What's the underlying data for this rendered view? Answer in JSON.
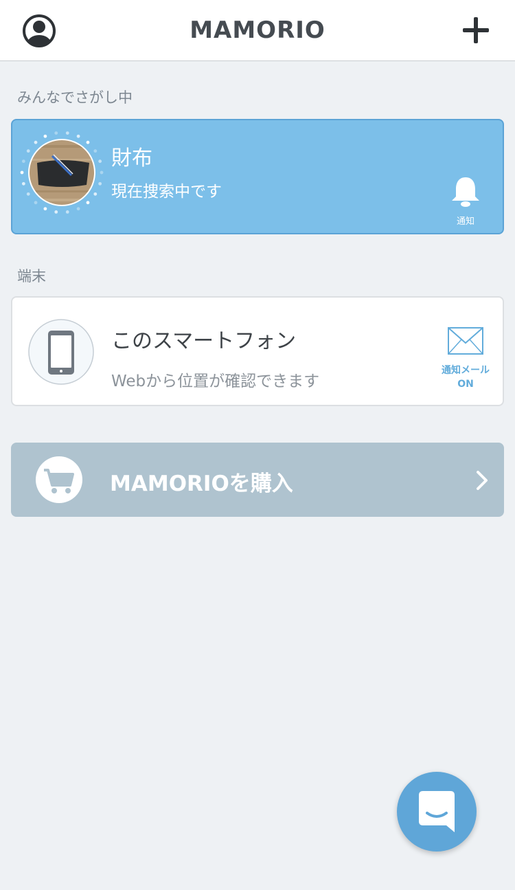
{
  "header": {
    "logo_text": "MAMORIO",
    "profile_icon": "user-circle-icon",
    "add_icon": "plus-icon"
  },
  "sections": {
    "searching_label": "みんなでさがし中",
    "devices_label": "端末"
  },
  "searching_item": {
    "name": "財布",
    "status": "現在捜索中です",
    "notify_label": "通知",
    "notify_icon": "bell-icon",
    "background_color": "#7cbfe9"
  },
  "device_item": {
    "name": "このスマートフォン",
    "status": "Webから位置が確認できます",
    "mail_label": "通知メール",
    "mail_state": "ON",
    "mail_icon": "envelope-icon",
    "device_icon": "smartphone-icon"
  },
  "purchase": {
    "label": "MAMORIOを購入",
    "icon": "cart-icon",
    "chevron_icon": "chevron-right-icon"
  },
  "chat": {
    "icon": "chat-bubble-icon",
    "color": "#5fa6d8"
  }
}
